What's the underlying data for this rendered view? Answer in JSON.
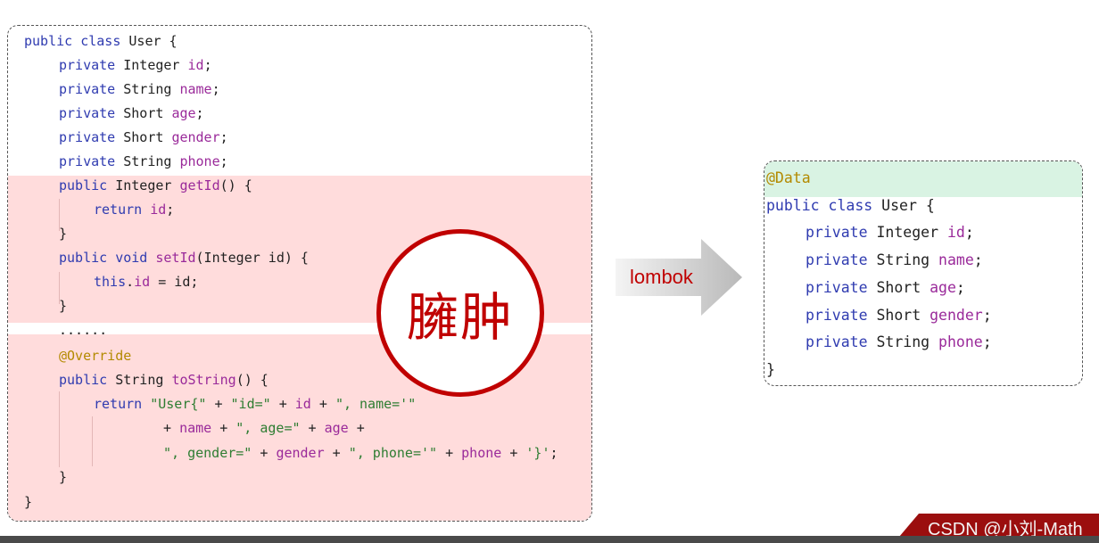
{
  "left_code": {
    "l1": [
      "public class",
      " User {"
    ],
    "l2": [
      "private",
      " Integer ",
      "id",
      ";"
    ],
    "l3": [
      "private",
      " String ",
      "name",
      ";"
    ],
    "l4": [
      "private",
      " Short ",
      "age",
      ";"
    ],
    "l5": [
      "private",
      " Short ",
      "gender",
      ";"
    ],
    "l6": [
      "private",
      " String ",
      "phone",
      ";"
    ],
    "l7": [
      "public",
      " Integer ",
      "getId",
      "() {"
    ],
    "l8": [
      "return",
      " ",
      "id",
      ";"
    ],
    "l9": "}",
    "l10": [
      "public",
      " ",
      "void",
      " ",
      "setId",
      "(Integer id) {"
    ],
    "l11": [
      "this",
      ".",
      "id",
      " = id;"
    ],
    "l12": "}",
    "l13": "......",
    "l14": "@Override",
    "l15": [
      "public",
      " String ",
      "toString",
      "() {"
    ],
    "l16": [
      "return",
      " ",
      "\"User{\"",
      " + ",
      "\"id=\"",
      " + ",
      "id",
      " + ",
      "\", name='\""
    ],
    "l17": [
      "+ ",
      "name",
      " + ",
      "\", age=\"",
      " + ",
      "age",
      " +"
    ],
    "l18": [
      "\", gender=\"",
      " + ",
      "gender",
      " + ",
      "\", phone='\"",
      " + ",
      "phone",
      " + ",
      "'}'",
      ";"
    ],
    "l19": "}",
    "l20": "}"
  },
  "stamp_text": "臃肿",
  "arrow_label": "lombok",
  "right_code": {
    "annotation": "@Data",
    "l1": [
      "public class",
      " User {"
    ],
    "l2": [
      "private",
      " Integer ",
      "id",
      ";"
    ],
    "l3": [
      "private",
      " String ",
      "name",
      ";"
    ],
    "l4": [
      "private",
      " Short ",
      "age",
      ";"
    ],
    "l5": [
      "private",
      " Short ",
      "gender",
      ";"
    ],
    "l6": [
      "private",
      " String ",
      "phone",
      ";"
    ],
    "l7": "}"
  },
  "watermark": "CSDN @小刘-Math",
  "colors": {
    "keyword": "#2f3bb0",
    "field": "#9a2a9a",
    "string": "#2e7d32",
    "annotation": "#b38a00",
    "stamp": "#c00000",
    "bloat_highlight": "#ffdcdc",
    "annotation_highlight": "#d9f3e3"
  }
}
